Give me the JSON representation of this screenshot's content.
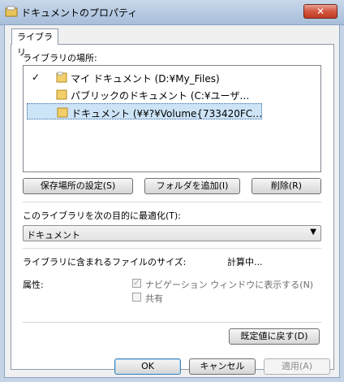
{
  "window": {
    "title": "ドキュメントのプロパティ",
    "close_label": "✕"
  },
  "tabs": [
    {
      "label": "ライブラリ"
    }
  ],
  "library_locations": {
    "label": "ライブラリの場所:",
    "items": [
      {
        "check": "✓",
        "text": "マイ ドキュメント (D:¥My_Files)",
        "selected": false
      },
      {
        "check": "",
        "text": "パブリックのドキュメント (C:¥ユーザ…",
        "selected": false
      },
      {
        "check": "",
        "text": "ドキュメント (¥¥?¥Volume{733420FC…",
        "selected": true
      }
    ]
  },
  "buttons": {
    "set_save_location": "保存場所の設定(S)",
    "add_folder": "フォルダを追加(I)",
    "remove": "削除(R)",
    "restore_defaults": "既定値に戻す(D)",
    "ok": "OK",
    "cancel": "キャンセル",
    "apply": "適用(A)"
  },
  "optimize": {
    "label": "このライブラリを次の目的に最適化(T):",
    "selected": "ドキュメント"
  },
  "size": {
    "label": "ライブラリに含まれるファイルのサイズ:",
    "value": "計算中..."
  },
  "attributes": {
    "label": "属性:",
    "show_in_nav": "ナビゲーション ウィンドウに表示する(N)",
    "shared": "共有"
  }
}
